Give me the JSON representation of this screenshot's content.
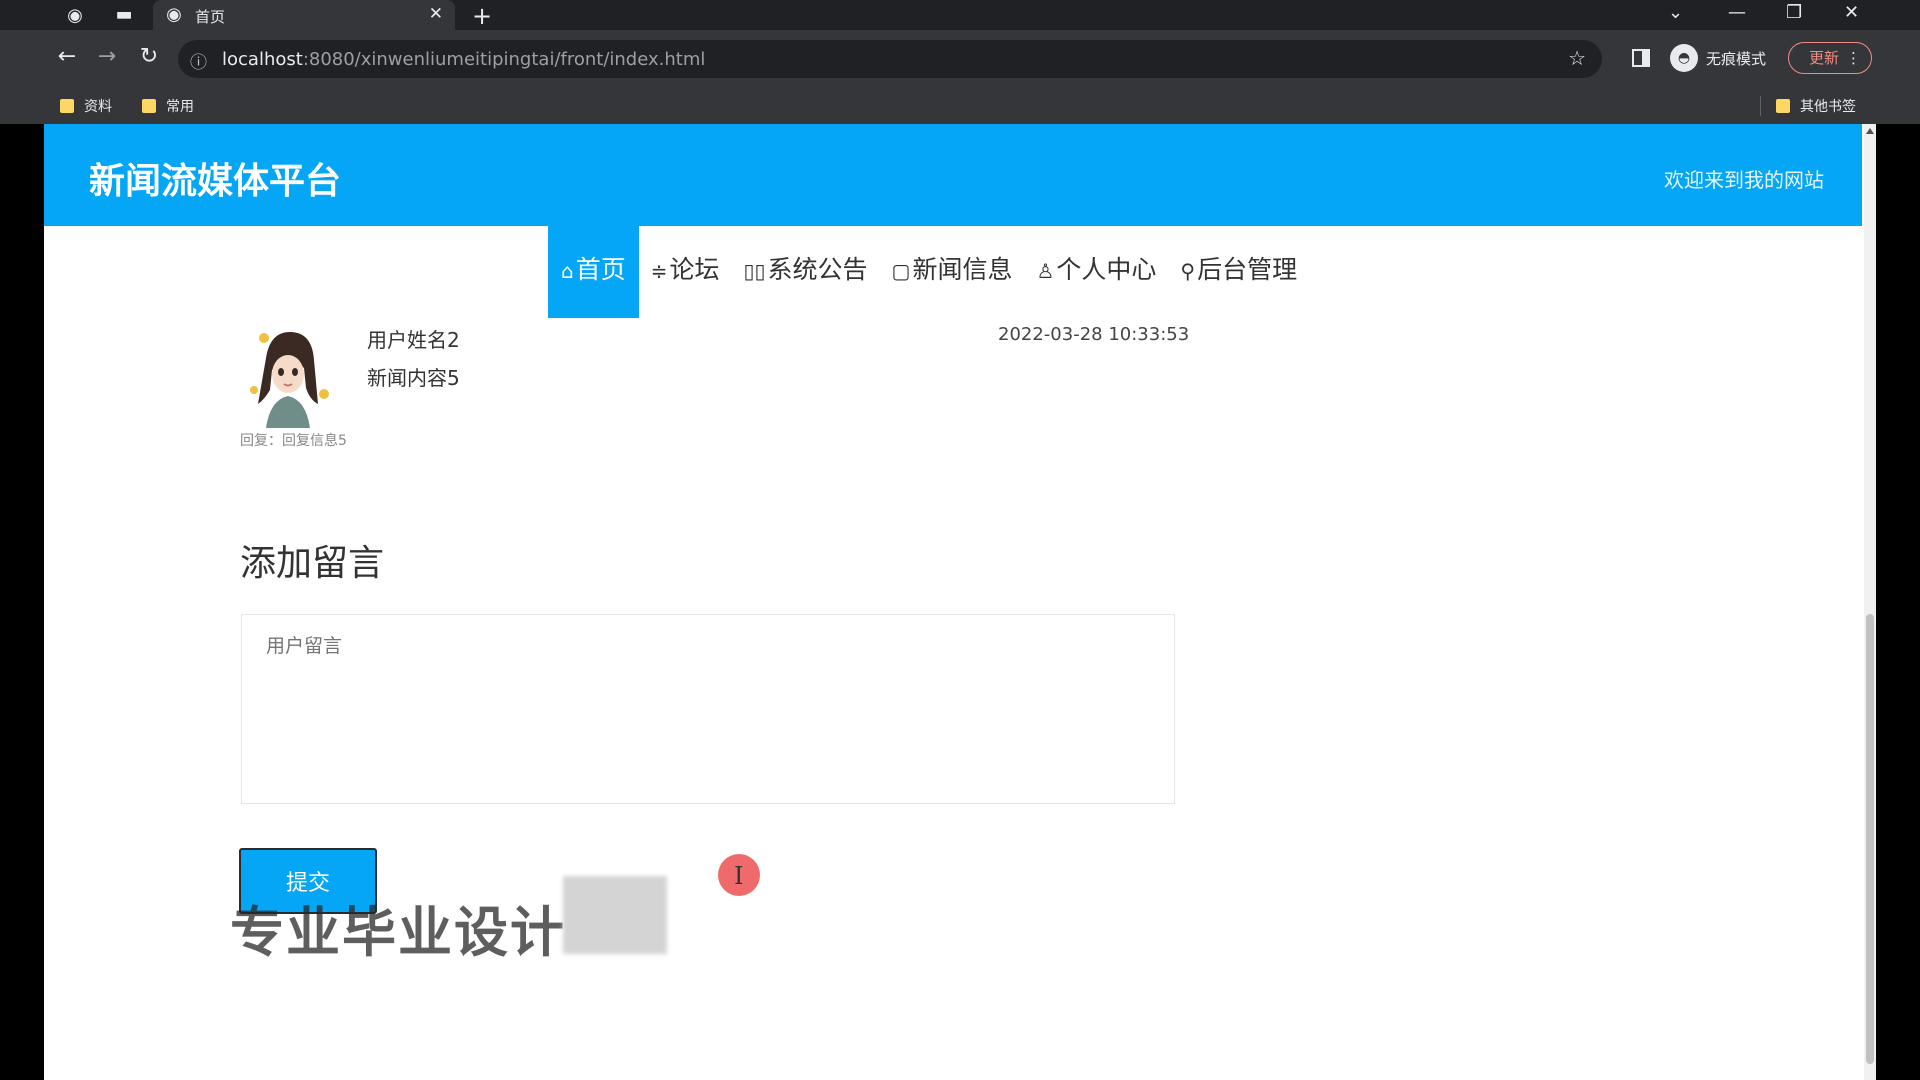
{
  "browser": {
    "tab_title": "首页",
    "url_host": "localhost",
    "url_rest": ":8080/xinwenliumeitipingtai/front/index.html",
    "incognito_label": "无痕模式",
    "update_label": "更新",
    "bookmarks": [
      "资料",
      "常用"
    ],
    "other_bookmarks": "其他书签"
  },
  "site": {
    "title": "新闻流媒体平台",
    "welcome": "欢迎来到我的网站",
    "accent_color": "#05a6f5"
  },
  "nav": {
    "items": [
      {
        "icon": "⌂",
        "label": "首页"
      },
      {
        "icon": "≑",
        "label": "论坛"
      },
      {
        "icon": "▯▯",
        "label": "系统公告"
      },
      {
        "icon": "▢",
        "label": "新闻信息"
      },
      {
        "icon": "♙",
        "label": "个人中心"
      },
      {
        "icon": "⚲",
        "label": "后台管理"
      }
    ]
  },
  "comment": {
    "user_name": "用户姓名2",
    "content": "新闻内容5",
    "time": "2022-03-28 10:33:53",
    "reply": "回复：回复信息5"
  },
  "form": {
    "title": "添加留言",
    "placeholder": "用户留言",
    "submit_label": "提交"
  },
  "overlay": {
    "watermark_text": "专业毕业设计"
  }
}
